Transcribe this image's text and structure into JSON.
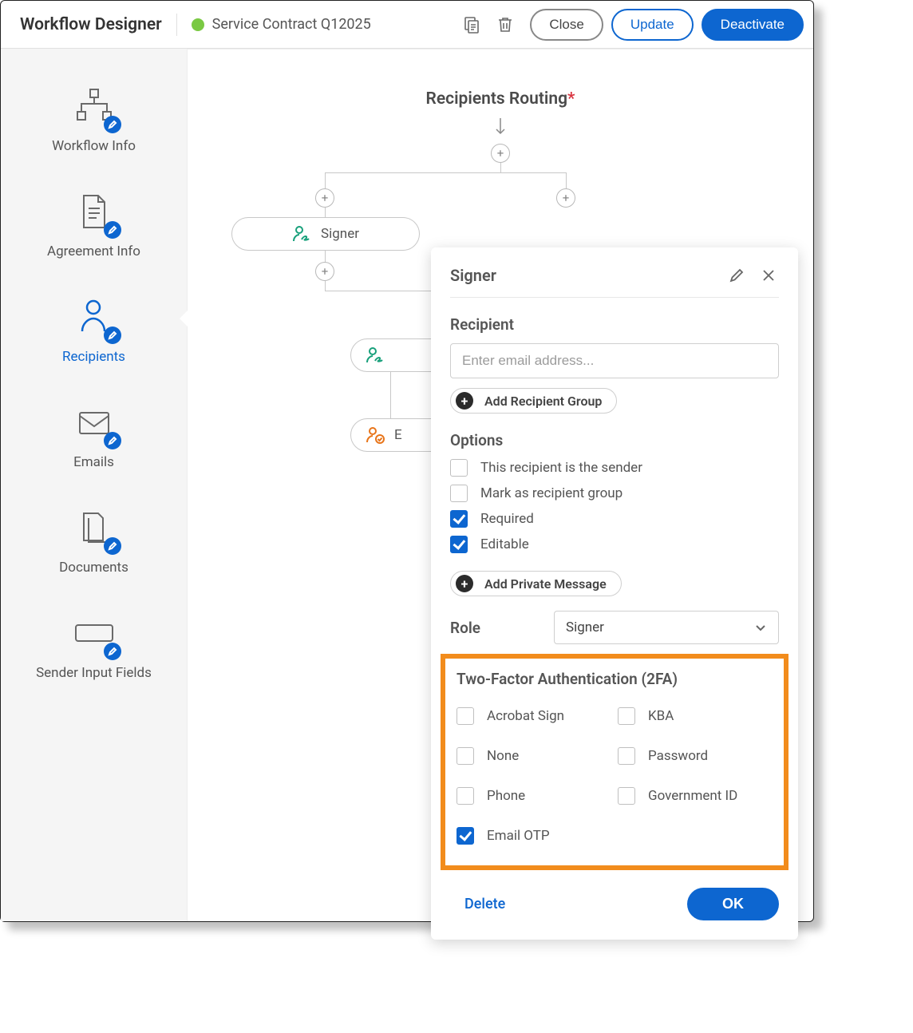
{
  "header": {
    "app_title": "Workflow Designer",
    "workflow_name": "Service Contract Q12025",
    "buttons": {
      "close": "Close",
      "update": "Update",
      "deactivate": "Deactivate"
    }
  },
  "sidebar": {
    "items": [
      {
        "label": "Workflow Info"
      },
      {
        "label": "Agreement Info"
      },
      {
        "label": "Recipients"
      },
      {
        "label": "Emails"
      },
      {
        "label": "Documents"
      },
      {
        "label": "Sender Input Fields"
      }
    ],
    "active_index": 2
  },
  "canvas": {
    "title": "Recipients Routing",
    "required_marker": "*",
    "nodes": {
      "signer": "Signer",
      "second_row_prefix": "E"
    }
  },
  "popover": {
    "title": "Signer",
    "recipient_label": "Recipient",
    "recipient_placeholder": "Enter email address...",
    "add_recipient_group": "Add Recipient Group",
    "options_label": "Options",
    "checkboxes": {
      "is_sender": {
        "label": "This recipient is the sender",
        "checked": false
      },
      "mark_group": {
        "label": "Mark as recipient group",
        "checked": false
      },
      "required": {
        "label": "Required",
        "checked": true
      },
      "editable": {
        "label": "Editable",
        "checked": true
      }
    },
    "add_private_message": "Add Private Message",
    "role_label": "Role",
    "role_value": "Signer",
    "twofa": {
      "title": "Two-Factor Authentication (2FA)",
      "options": [
        {
          "label": "Acrobat Sign",
          "checked": false
        },
        {
          "label": "KBA",
          "checked": false
        },
        {
          "label": "None",
          "checked": false
        },
        {
          "label": "Password",
          "checked": false
        },
        {
          "label": "Phone",
          "checked": false
        },
        {
          "label": "Government ID",
          "checked": false
        },
        {
          "label": "Email OTP",
          "checked": true
        }
      ]
    },
    "footer": {
      "delete": "Delete",
      "ok": "OK"
    }
  }
}
